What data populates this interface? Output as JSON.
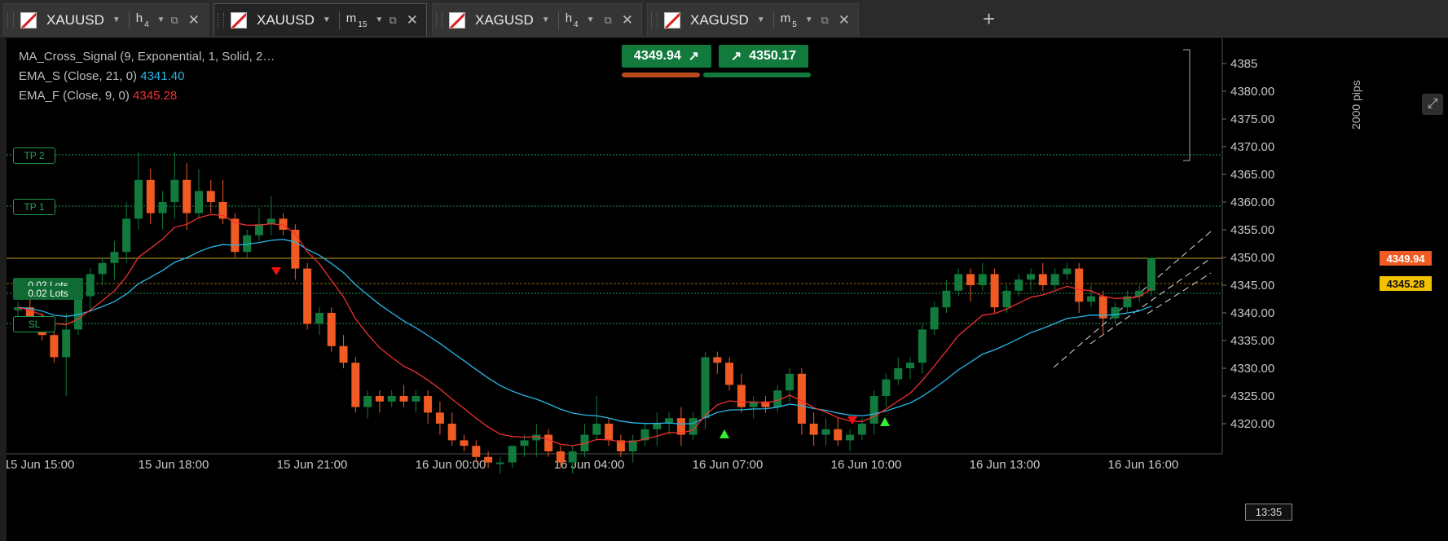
{
  "tabs": [
    {
      "symbol": "XAUUSD",
      "timeframe": "h",
      "tf_sub": "4",
      "active": false
    },
    {
      "symbol": "XAUUSD",
      "timeframe": "m",
      "tf_sub": "15",
      "active": true
    },
    {
      "symbol": "XAGUSD",
      "timeframe": "h",
      "tf_sub": "4",
      "active": false
    },
    {
      "symbol": "XAGUSD",
      "timeframe": "m",
      "tf_sub": "5",
      "active": false
    }
  ],
  "add_tab_label": "+",
  "legend": {
    "ma_cross": "MA_Cross_Signal (9, Exponential, 1, Solid, 2…",
    "ema_s_label": "EMA_S (Close, 21, 0)",
    "ema_s_value": "4341.40",
    "ema_f_label": "EMA_F (Close, 9, 0)",
    "ema_f_value": "4345.28"
  },
  "quote": {
    "bid": "4349.94",
    "ask": "4350.17"
  },
  "orders": {
    "tp2": "TP 2",
    "tp1": "TP 1",
    "sl": "SL",
    "lots1": "0.02 Lots",
    "lots2": "0.02 Lots"
  },
  "price_tags": {
    "bid": "4349.94",
    "ema": "4345.28"
  },
  "price_axis": [
    "4385",
    "4380.00",
    "4375.00",
    "4370.00",
    "4365.00",
    "4360.00",
    "4355.00",
    "4350.00",
    "4345.00",
    "4340.00",
    "4335.00",
    "4330.00",
    "4325.00",
    "4320.00"
  ],
  "time_axis": [
    "15 Jun 15:00",
    "15 Jun 18:00",
    "15 Jun 21:00",
    "16 Jun 00:00",
    "16 Jun 04:00",
    "16 Jun 07:00",
    "16 Jun 10:00",
    "16 Jun 13:00",
    "16 Jun 16:00"
  ],
  "pips_label": "2000 pips",
  "crosshair_time": "13:35",
  "colors": {
    "bull": "#127a3c",
    "bear": "#f05a23",
    "ema_s": "#29b6e8",
    "ema_f": "#f03030",
    "grid_green": "#1e9a50",
    "price_line": "#c8a020"
  },
  "icons": {
    "arrow_up_right": "↗",
    "popout": "⧉",
    "close": "✕",
    "maximize": "⤢"
  }
}
